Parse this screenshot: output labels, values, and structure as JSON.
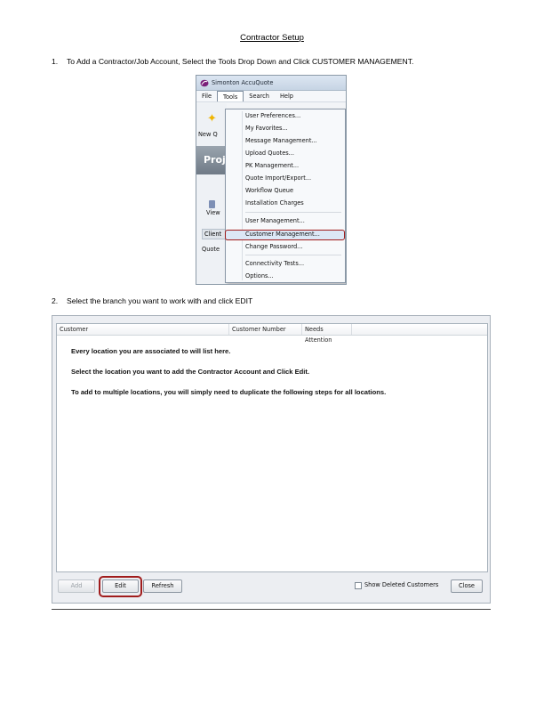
{
  "document": {
    "title": "Contractor Setup",
    "step1": {
      "number": "1.",
      "text": "To Add a Contractor/Job Account, Select the Tools Drop Down and Click CUSTOMER MANAGEMENT."
    },
    "step2": {
      "number": "2.",
      "text": "Select the branch you want to work with and click EDIT"
    }
  },
  "menu_screenshot": {
    "app_title": "Simonton AccuQuote",
    "menubar": [
      "File",
      "Tools",
      "Search",
      "Help"
    ],
    "left_panel": {
      "new_label": "New Q",
      "proj_label": "Proj",
      "view_label": "View",
      "client_label": "Client",
      "quote_label": "Quote"
    },
    "tools_menu": [
      "User Preferences...",
      "My Favorites...",
      "Message Management...",
      "Upload Quotes...",
      "PK Management...",
      "Quote Import/Export...",
      "Workflow Queue",
      "Installation Charges",
      "User Management...",
      "Customer Management...",
      "Change Password...",
      "Connectivity Tests...",
      "Options..."
    ],
    "highlighted_item": "Customer Management...",
    "accent_color": "#a01c1c"
  },
  "customer_screenshot": {
    "columns": [
      "Customer",
      "Customer Number",
      "Needs Attention"
    ],
    "messages": [
      "Every location you are associated to will list here.",
      "Select the location you want to add the Contractor Account and Click Edit.",
      "To add to multiple locations, you will simply need to duplicate the following steps for all locations."
    ],
    "buttons": {
      "add": "Add",
      "edit": "Edit",
      "refresh": "Refresh",
      "close": "Close"
    },
    "show_deleted_label": "Show Deleted Customers",
    "show_deleted_checked": false
  }
}
